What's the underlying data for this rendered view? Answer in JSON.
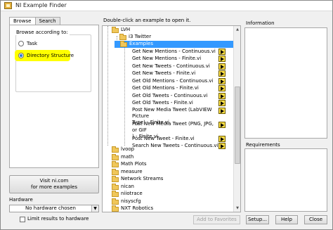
{
  "window": {
    "title": "NI Example Finder"
  },
  "tabs": [
    {
      "label": "Browse",
      "active": true
    },
    {
      "label": "Search",
      "active": false
    }
  ],
  "browse": {
    "group_label": "Browse according to:",
    "options": [
      {
        "label": "Task",
        "selected": false
      },
      {
        "label": "Directory Structure",
        "selected": true
      }
    ]
  },
  "visit_button": {
    "line1": "Visit ni.com",
    "line2": "for more examples"
  },
  "hardware": {
    "label": "Hardware",
    "selected": "No hardware chosen",
    "limit_label": "Limit results to hardware",
    "limit_checked": false
  },
  "list": {
    "header": "Double-click an example to open it.",
    "top_items": [
      {
        "label": "LVH"
      },
      {
        "label": "i3 Twitter"
      },
      {
        "label": "Examples",
        "selected": true
      }
    ],
    "examples": [
      {
        "label": "Get New Mentions - Continuous.vi"
      },
      {
        "label": "Get New Mentions - Finite.vi"
      },
      {
        "label": "Get New Tweets - Continuous.vi"
      },
      {
        "label": "Get New Tweets - Finite.vi"
      },
      {
        "label": "Get Old Mentions - Continuous.vi"
      },
      {
        "label": "Get Old Mentions - Finite.vi"
      },
      {
        "label": "Get Old Tweets - Continuous.vi"
      },
      {
        "label": "Get Old Tweets - Finite.vi"
      },
      {
        "label": "Post New Media Tweet (LabVIEW Picture Type) - Finite.vi",
        "lines": [
          "Post New Media Tweet (LabVIEW Picture",
          "Type) - Finite.vi"
        ]
      },
      {
        "label": "Post New Media Tweet (PNG, JPG, or GIF) - Finite.vi",
        "lines": [
          "Post New Media Tweet (PNG, JPG, or GIF",
          ") - Finite.vi"
        ]
      },
      {
        "label": "Post New Tweet - Finite.vi"
      },
      {
        "label": "Search New Tweets - Continuous.vi"
      }
    ],
    "folders": [
      {
        "label": "lvoop"
      },
      {
        "label": "math"
      },
      {
        "label": "Math Plots"
      },
      {
        "label": "measure"
      },
      {
        "label": "Network Streams"
      },
      {
        "label": "nican"
      },
      {
        "label": "niiotrace"
      },
      {
        "label": "nisyscfg"
      },
      {
        "label": "NXT Robotics"
      }
    ],
    "add_favorites": "Add to Favorites"
  },
  "info": {
    "label": "Information",
    "requirements_label": "Requirements"
  },
  "buttons": {
    "setup": "Setup...",
    "help": "Help",
    "close": "Close"
  },
  "colors": {
    "selection": "#3399ff",
    "highlight": "#ffff00",
    "folder": "#f0c75a",
    "run_icon": "#ffe14a"
  }
}
